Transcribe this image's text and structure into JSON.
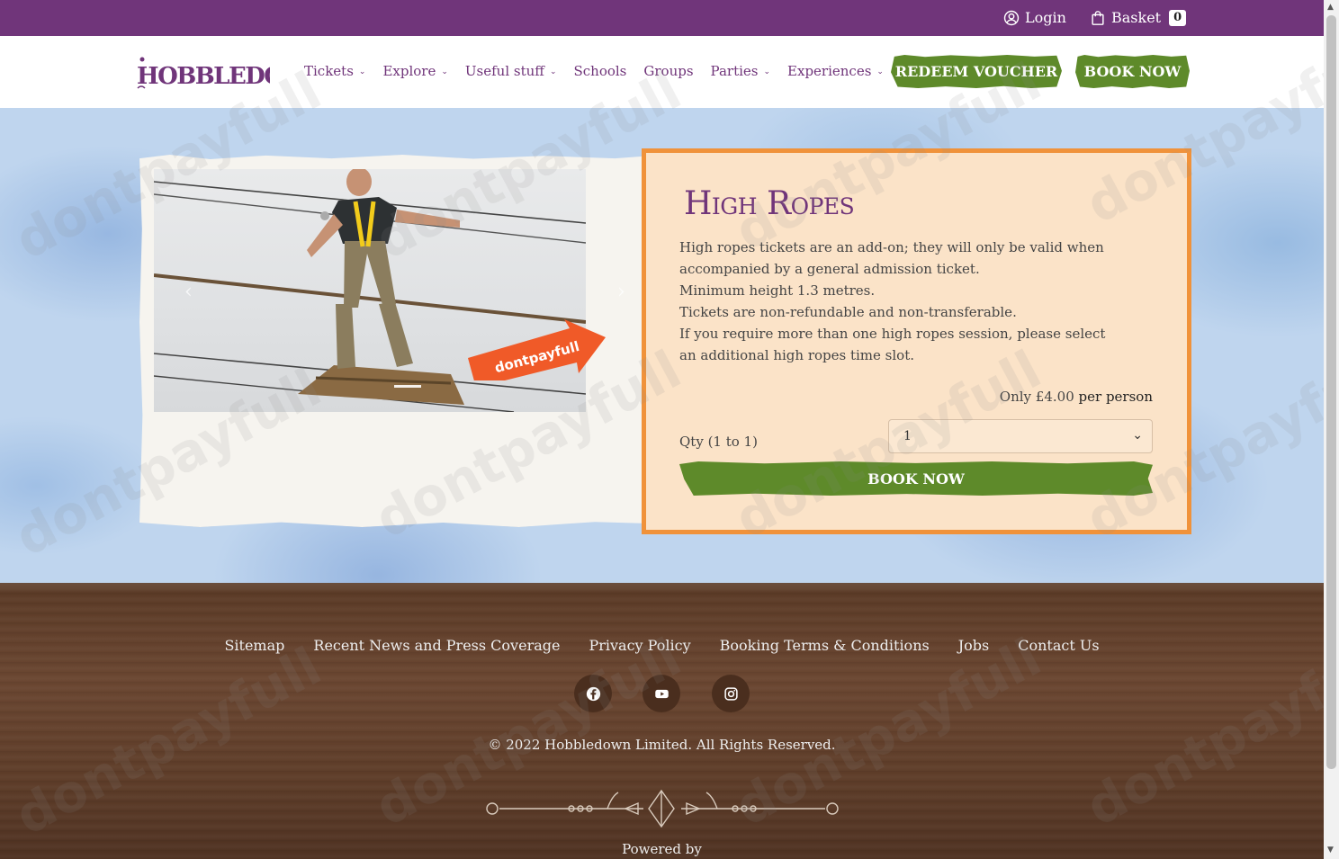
{
  "topbar": {
    "login_label": "Login",
    "basket_label": "Basket",
    "basket_count": "0"
  },
  "header": {
    "logo_text": "HOBBLEDOWN",
    "nav": [
      {
        "label": "Tickets",
        "dropdown": true
      },
      {
        "label": "Explore",
        "dropdown": true
      },
      {
        "label": "Useful stuff",
        "dropdown": true
      },
      {
        "label": "Schools",
        "dropdown": false
      },
      {
        "label": "Groups",
        "dropdown": false
      },
      {
        "label": "Parties",
        "dropdown": true
      },
      {
        "label": "Experiences",
        "dropdown": true
      }
    ],
    "redeem_label": "REDEEM VOUCHER",
    "book_label": "BOOK NOW"
  },
  "carousel": {
    "prev_icon": "chevron-left-icon",
    "next_icon": "chevron-right-icon",
    "ribbon_text": "dontpayfull"
  },
  "product": {
    "title": "High Ropes",
    "description": [
      "High ropes tickets are an add-on; they will only be valid when accompanied by a general admission ticket.",
      "Minimum height 1.3 metres.",
      "Tickets are non-refundable and non-transferable.",
      "If you require more than one high ropes session, please select an additional high ropes time slot."
    ],
    "price_prefix": "Only",
    "price_amount": "£4.00",
    "price_suffix": "per person",
    "qty_label": "Qty (1 to 1)",
    "qty_value": "1",
    "book_label": "BOOK NOW"
  },
  "footer": {
    "links": [
      "Sitemap",
      "Recent News and Press Coverage",
      "Privacy Policy",
      "Booking Terms & Conditions",
      "Jobs",
      "Contact Us"
    ],
    "social": [
      "facebook-icon",
      "youtube-icon",
      "instagram-icon"
    ],
    "copyright": "© 2022 Hobbledown Limited. All Rights Reserved.",
    "powered_by": "Powered by"
  },
  "watermark": "dontpayfull",
  "colors": {
    "brand_purple": "#70357a",
    "button_green": "#5e8a2a",
    "panel_orange": "#f0923a",
    "panel_bg": "#fbe3c8",
    "footer_brown": "#5e3d29"
  }
}
